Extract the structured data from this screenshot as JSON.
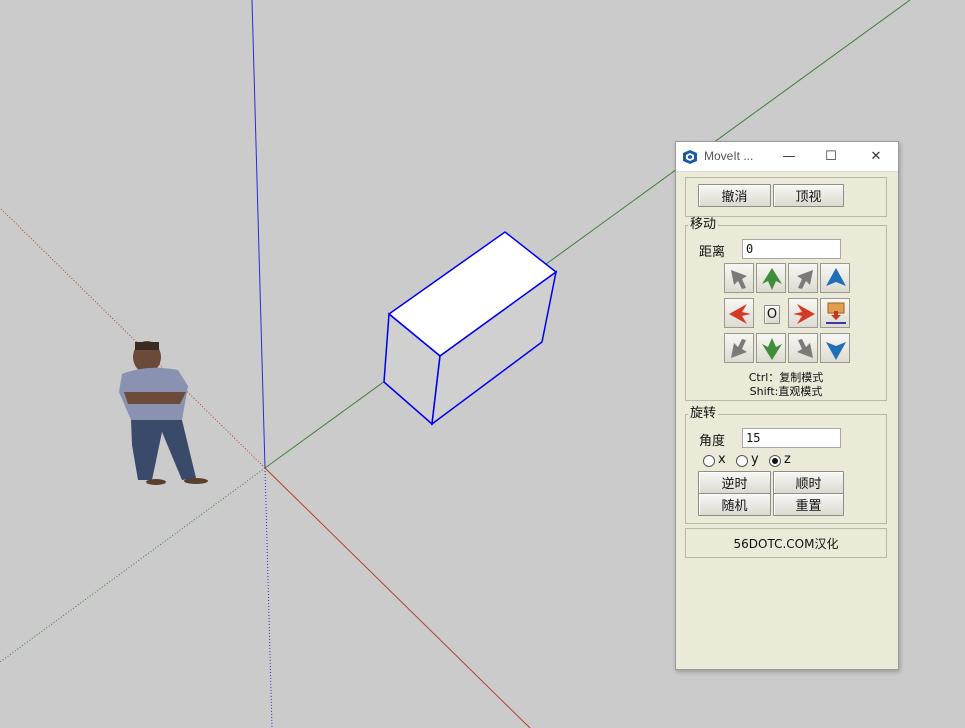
{
  "window": {
    "title": "MoveIt ...",
    "minimize_glyph": "—",
    "maximize_glyph": "☐",
    "close_glyph": "✕",
    "app_icon": "sketchup-icon"
  },
  "toolbar": {
    "undo_label": "撤消",
    "topview_label": "顶视"
  },
  "move": {
    "legend": "移动",
    "distance_label": "距离",
    "distance_value": "0",
    "center_button_label": "O",
    "arrows": [
      {
        "name": "move-left-back-arrow",
        "icon": "arrow-diagonal-up-left",
        "color": "#7a7a7a"
      },
      {
        "name": "move-up-green-arrow",
        "icon": "arrow-up",
        "color": "#3f8f3a"
      },
      {
        "name": "move-right-back-arrow",
        "icon": "arrow-diagonal-up-right",
        "color": "#7a7a7a"
      },
      {
        "name": "move-up-blue-arrow",
        "icon": "arrow-up",
        "color": "#1f6fb8"
      },
      {
        "name": "move-left-red-arrow",
        "icon": "arrow-left",
        "color": "#d23a26"
      },
      {
        "name": "move-right-red-arrow",
        "icon": "arrow-right",
        "color": "#d23a26"
      },
      {
        "name": "drop-to-ground-icon",
        "icon": "drop-down",
        "color": "#d27a2a"
      },
      {
        "name": "move-left-front-arrow",
        "icon": "arrow-diagonal-down-left",
        "color": "#7a7a7a"
      },
      {
        "name": "move-down-green-arrow",
        "icon": "arrow-down",
        "color": "#3f8f3a"
      },
      {
        "name": "move-right-front-arrow",
        "icon": "arrow-diagonal-down-right",
        "color": "#7a7a7a"
      },
      {
        "name": "move-down-blue-arrow",
        "icon": "arrow-down",
        "color": "#1f6fb8"
      }
    ],
    "hint_ctrl": "Ctrl：复制模式",
    "hint_shift": "Shift:直观模式"
  },
  "rotate": {
    "legend": "旋转",
    "angle_label": "角度",
    "angle_value": "15",
    "axes": [
      {
        "label": "x",
        "selected": false
      },
      {
        "label": "y",
        "selected": false
      },
      {
        "label": "z",
        "selected": true
      }
    ],
    "ccw_label": "逆时",
    "cw_label": "顺时",
    "random_label": "随机",
    "reset_label": "重置"
  },
  "footer": {
    "credit": "56DOTC.COM汉化"
  },
  "scene": {
    "background": "#cbcbcb",
    "axis_colors": {
      "red": "#b4422c",
      "green": "#3e7f3a",
      "blue": "#2b2bd8"
    },
    "box_face_top": "#ffffff",
    "box_face_side": "#d0d0d0",
    "selection_color": "#0000ee"
  }
}
